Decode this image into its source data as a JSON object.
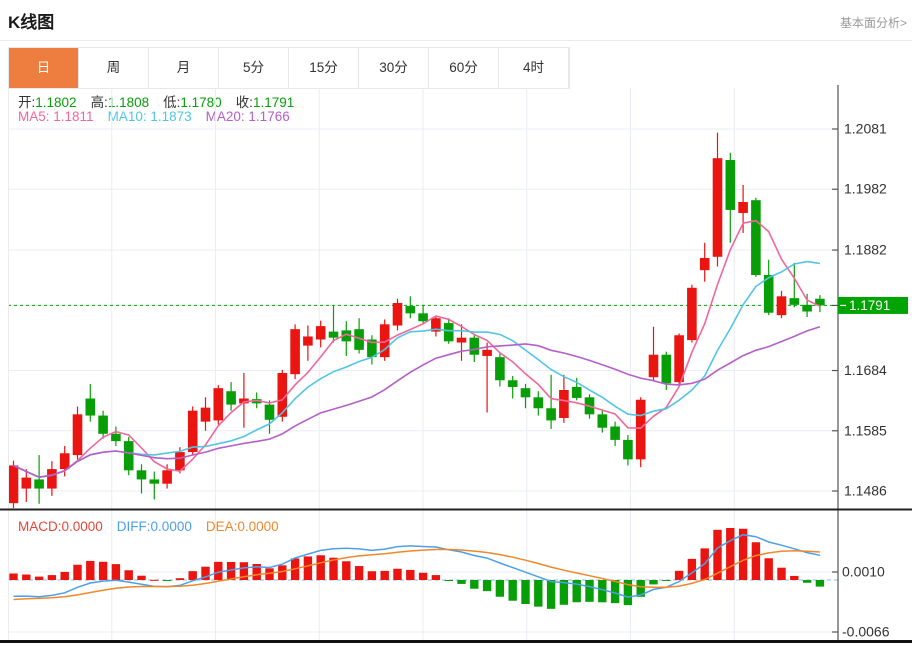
{
  "header": {
    "title": "K线图",
    "link": "基本面分析>"
  },
  "tabs": {
    "active_index": 0,
    "items": [
      {
        "label": "日",
        "name": "tab-day"
      },
      {
        "label": "周",
        "name": "tab-week"
      },
      {
        "label": "月",
        "name": "tab-month"
      },
      {
        "label": "5分",
        "name": "tab-5min"
      },
      {
        "label": "15分",
        "name": "tab-15min"
      },
      {
        "label": "30分",
        "name": "tab-30min"
      },
      {
        "label": "60分",
        "name": "tab-60min"
      },
      {
        "label": "4时",
        "name": "tab-4hour"
      }
    ]
  },
  "legend": {
    "ohlc": [
      {
        "label": "开:",
        "value": "1.1802"
      },
      {
        "label": "高:",
        "value": "1.1808"
      },
      {
        "label": "低:",
        "value": "1.1780"
      },
      {
        "label": "收:",
        "value": "1.1791"
      }
    ],
    "ma": [
      {
        "label": "MA5:",
        "value": "1.1811",
        "color": "#f0679e"
      },
      {
        "label": "MA10:",
        "value": "1.1873",
        "color": "#52c5e5"
      },
      {
        "label": "MA20:",
        "value": "1.1766",
        "color": "#b55fc9"
      }
    ],
    "macd": [
      {
        "label": "MACD:",
        "value": "0.0000",
        "color": "#e8463a"
      },
      {
        "label": "DIFF:",
        "value": "0.0000",
        "color": "#4da0e8"
      },
      {
        "label": "DEA:",
        "value": "0.0000",
        "color": "#f0882a"
      }
    ]
  },
  "colors": {
    "up": "#ea1410",
    "down": "#089e08",
    "tag_bg": "#00a400",
    "price_line": "#0aa00a",
    "grid": "#e9eef4",
    "axis_text": "#333333",
    "axis_line": "#555555",
    "zero_line": "#86bce8",
    "diff": "#4da0e8",
    "dea": "#f0882a",
    "tab_active": "#ee7e40"
  },
  "chart_data": {
    "type": "candlestick",
    "main": {
      "title": "K线图 daily candles",
      "ylim": [
        1.1486,
        1.2081
      ],
      "y_ticks": [
        "1.2081",
        "1.1982",
        "1.1882",
        "1.1791",
        "1.1684",
        "1.1585",
        "1.1486"
      ],
      "current_price": "1.1791",
      "ma_periods": [
        5,
        10,
        20
      ],
      "v_divisions": 8,
      "ohlc": [
        [
          1.1466,
          1.1536,
          1.1458,
          1.1528
        ],
        [
          1.149,
          1.1522,
          1.1468,
          1.1508
        ],
        [
          1.1505,
          1.1545,
          1.1465,
          1.149
        ],
        [
          1.149,
          1.1535,
          1.1478,
          1.1522
        ],
        [
          1.1522,
          1.156,
          1.151,
          1.1548
        ],
        [
          1.1545,
          1.1625,
          1.1538,
          1.1612
        ],
        [
          1.1638,
          1.1662,
          1.16,
          1.161
        ],
        [
          1.161,
          1.1618,
          1.1572,
          1.158
        ],
        [
          1.158,
          1.1592,
          1.156,
          1.1568
        ],
        [
          1.1568,
          1.1575,
          1.1512,
          1.152
        ],
        [
          1.152,
          1.153,
          1.1482,
          1.1505
        ],
        [
          1.1505,
          1.1518,
          1.1472,
          1.1498
        ],
        [
          1.1498,
          1.153,
          1.149,
          1.152
        ],
        [
          1.152,
          1.1558,
          1.1515,
          1.155
        ],
        [
          1.155,
          1.1625,
          1.1545,
          1.1618
        ],
        [
          1.16,
          1.164,
          1.1585,
          1.1623
        ],
        [
          1.1602,
          1.166,
          1.1595,
          1.1655
        ],
        [
          1.165,
          1.1665,
          1.1618,
          1.1628
        ],
        [
          1.163,
          1.168,
          1.159,
          1.1638
        ],
        [
          1.1637,
          1.1648,
          1.1622,
          1.163
        ],
        [
          1.1628,
          1.1635,
          1.158,
          1.1603
        ],
        [
          1.1608,
          1.1685,
          1.16,
          1.168
        ],
        [
          1.1678,
          1.176,
          1.167,
          1.1752
        ],
        [
          1.1725,
          1.1758,
          1.17,
          1.174
        ],
        [
          1.1735,
          1.1766,
          1.1722,
          1.1757
        ],
        [
          1.1748,
          1.179,
          1.173,
          1.1738
        ],
        [
          1.175,
          1.1765,
          1.1708,
          1.1732
        ],
        [
          1.1752,
          1.177,
          1.1712,
          1.1718
        ],
        [
          1.1735,
          1.1742,
          1.1694,
          1.1706
        ],
        [
          1.1706,
          1.1768,
          1.17,
          1.176
        ],
        [
          1.1758,
          1.1802,
          1.175,
          1.1795
        ],
        [
          1.179,
          1.1806,
          1.177,
          1.1778
        ],
        [
          1.1778,
          1.1792,
          1.176,
          1.1765
        ],
        [
          1.1748,
          1.1772,
          1.174,
          1.177
        ],
        [
          1.1762,
          1.177,
          1.1728,
          1.1732
        ],
        [
          1.173,
          1.176,
          1.17,
          1.1738
        ],
        [
          1.1738,
          1.1742,
          1.1698,
          1.171
        ],
        [
          1.1708,
          1.173,
          1.1615,
          1.1718
        ],
        [
          1.1706,
          1.1712,
          1.1658,
          1.1668
        ],
        [
          1.1668,
          1.1675,
          1.1638,
          1.1657
        ],
        [
          1.1655,
          1.1662,
          1.1622,
          1.164
        ],
        [
          1.164,
          1.165,
          1.161,
          1.1622
        ],
        [
          1.1622,
          1.1677,
          1.1588,
          1.1602
        ],
        [
          1.1606,
          1.1677,
          1.1598,
          1.1652
        ],
        [
          1.1657,
          1.1672,
          1.1635,
          1.1639
        ],
        [
          1.164,
          1.1645,
          1.1605,
          1.1612
        ],
        [
          1.1612,
          1.162,
          1.1582,
          1.159
        ],
        [
          1.1592,
          1.16,
          1.156,
          1.157
        ],
        [
          1.157,
          1.1578,
          1.1528,
          1.1538
        ],
        [
          1.1538,
          1.164,
          1.1525,
          1.1636
        ],
        [
          1.1673,
          1.1756,
          1.1668,
          1.171
        ],
        [
          1.171,
          1.1715,
          1.1652,
          1.1663
        ],
        [
          1.1665,
          1.1745,
          1.166,
          1.1742
        ],
        [
          1.1734,
          1.1825,
          1.173,
          1.182
        ],
        [
          1.1849,
          1.1894,
          1.183,
          1.1869
        ],
        [
          1.1871,
          1.2075,
          1.1855,
          1.2033
        ],
        [
          1.203,
          1.2042,
          1.1894,
          1.1948
        ],
        [
          1.1943,
          1.1989,
          1.191,
          1.1961
        ],
        [
          1.1964,
          1.1968,
          1.1838,
          1.1841
        ],
        [
          1.1841,
          1.1866,
          1.1775,
          1.1779
        ],
        [
          1.1775,
          1.1815,
          1.177,
          1.1806
        ],
        [
          1.1803,
          1.1861,
          1.1788,
          1.1792
        ],
        [
          1.1792,
          1.181,
          1.1772,
          1.1781
        ],
        [
          1.1802,
          1.1808,
          1.178,
          1.1791
        ]
      ]
    },
    "macd": {
      "type": "bar",
      "derived_from_closes": true,
      "params": [
        12,
        26,
        9
      ],
      "y_ticks": [
        "0.0010",
        "-0.0066"
      ]
    }
  }
}
